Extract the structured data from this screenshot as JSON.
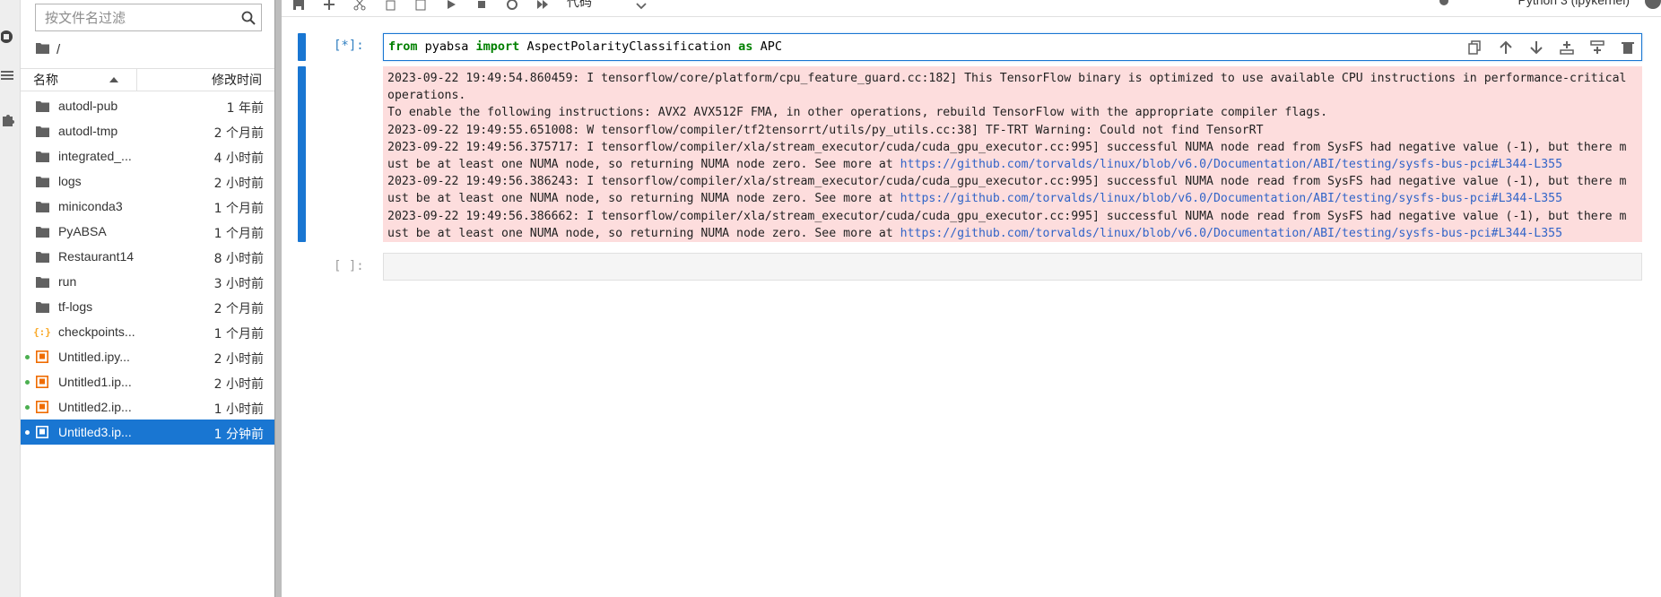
{
  "filebrowser": {
    "filter_placeholder": "按文件名过滤",
    "breadcrumb": "/",
    "header": {
      "name": "名称",
      "modified": "修改时间"
    },
    "items": [
      {
        "name": "autodl-pub",
        "modified": "1 年前",
        "type": "folder",
        "running": false,
        "selected": false
      },
      {
        "name": "autodl-tmp",
        "modified": "2 个月前",
        "type": "folder",
        "running": false,
        "selected": false
      },
      {
        "name": "integrated_...",
        "modified": "4 小时前",
        "type": "folder",
        "running": false,
        "selected": false
      },
      {
        "name": "logs",
        "modified": "2 小时前",
        "type": "folder",
        "running": false,
        "selected": false
      },
      {
        "name": "miniconda3",
        "modified": "1 个月前",
        "type": "folder",
        "running": false,
        "selected": false
      },
      {
        "name": "PyABSA",
        "modified": "1 个月前",
        "type": "folder",
        "running": false,
        "selected": false
      },
      {
        "name": "Restaurant14",
        "modified": "8 小时前",
        "type": "folder",
        "running": false,
        "selected": false
      },
      {
        "name": "run",
        "modified": "3 小时前",
        "type": "folder",
        "running": false,
        "selected": false
      },
      {
        "name": "tf-logs",
        "modified": "2 个月前",
        "type": "folder",
        "running": false,
        "selected": false
      },
      {
        "name": "checkpoints...",
        "modified": "1 个月前",
        "type": "json",
        "running": false,
        "selected": false
      },
      {
        "name": "Untitled.ipy...",
        "modified": "2 小时前",
        "type": "notebook",
        "running": true,
        "selected": false
      },
      {
        "name": "Untitled1.ip...",
        "modified": "2 小时前",
        "type": "notebook",
        "running": true,
        "selected": false
      },
      {
        "name": "Untitled2.ip...",
        "modified": "1 小时前",
        "type": "notebook",
        "running": true,
        "selected": false
      },
      {
        "name": "Untitled3.ip...",
        "modified": "1 分钟前",
        "type": "notebook",
        "running": true,
        "selected": true
      }
    ]
  },
  "toolbar": {
    "cell_type": "代码",
    "kernel_name": "Python 3 (ipykernel)"
  },
  "cells": {
    "cell1": {
      "prompt": "[*]:",
      "code": {
        "kw1": "from",
        "mod": " pyabsa ",
        "kw2": "import",
        "cls": " AspectPolarityClassification ",
        "kw3": "as",
        "alias": " APC"
      },
      "output": [
        {
          "text": "2023-09-22 19:49:54.860459: I tensorflow/core/platform/cpu_feature_guard.cc:182] This TensorFlow binary is optimized to use available CPU instructions in performance-critical",
          "link": ""
        },
        {
          "text": "operations.",
          "link": ""
        },
        {
          "text": "To enable the following instructions: AVX2 AVX512F FMA, in other operations, rebuild TensorFlow with the appropriate compiler flags.",
          "link": ""
        },
        {
          "text": "2023-09-22 19:49:55.651008: W tensorflow/compiler/tf2tensorrt/utils/py_utils.cc:38] TF-TRT Warning: Could not find TensorRT",
          "link": ""
        },
        {
          "text": "2023-09-22 19:49:56.375717: I tensorflow/compiler/xla/stream_executor/cuda/cuda_gpu_executor.cc:995] successful NUMA node read from SysFS had negative value (-1), but there m",
          "link": ""
        },
        {
          "text": "ust be at least one NUMA node, so returning NUMA node zero. See more at ",
          "link": "https://github.com/torvalds/linux/blob/v6.0/Documentation/ABI/testing/sysfs-bus-pci#L344-L355"
        },
        {
          "text": "2023-09-22 19:49:56.386243: I tensorflow/compiler/xla/stream_executor/cuda/cuda_gpu_executor.cc:995] successful NUMA node read from SysFS had negative value (-1), but there m",
          "link": ""
        },
        {
          "text": "ust be at least one NUMA node, so returning NUMA node zero. See more at ",
          "link": "https://github.com/torvalds/linux/blob/v6.0/Documentation/ABI/testing/sysfs-bus-pci#L344-L355"
        },
        {
          "text": "2023-09-22 19:49:56.386662: I tensorflow/compiler/xla/stream_executor/cuda/cuda_gpu_executor.cc:995] successful NUMA node read from SysFS had negative value (-1), but there m",
          "link": ""
        },
        {
          "text": "ust be at least one NUMA node, so returning NUMA node zero. See more at ",
          "link": "https://github.com/torvalds/linux/blob/v6.0/Documentation/ABI/testing/sysfs-bus-pci#L344-L355"
        }
      ]
    },
    "cell2": {
      "prompt": "[ ]:"
    }
  },
  "colors": {
    "accent": "#1976d2",
    "output_bg": "#fddddd",
    "link": "#3164c8",
    "running_dot": "#4caf50",
    "keyword": "#008000"
  }
}
